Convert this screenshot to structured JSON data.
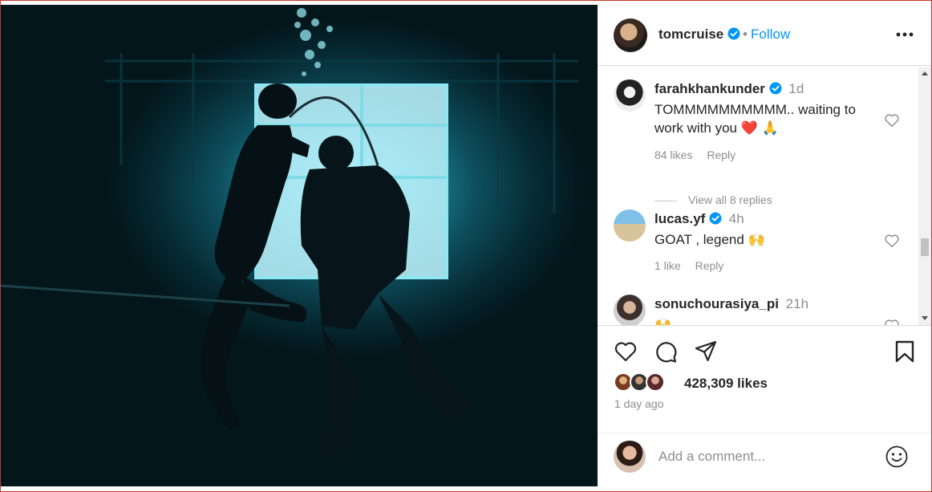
{
  "post": {
    "author": "tomcruise",
    "follow_label": "Follow",
    "separator": "•",
    "icons": {
      "verified": "verified-badge-icon",
      "more": "more-options-icon"
    }
  },
  "comments": [
    {
      "user": "farahkhankunder",
      "time": "1d",
      "text": "TOMMMMMMMMMM.. waiting to work with you ❤️ 🙏",
      "likes": "84 likes",
      "reply_label": "Reply",
      "view_replies": "View all 8 replies"
    },
    {
      "user": "lucas.yf",
      "time": "4h",
      "text": "GOAT , legend 🙌",
      "likes": "1 like",
      "reply_label": "Reply"
    },
    {
      "user": "sonuchourasiya_pi",
      "time": "21h",
      "text": "🙌"
    }
  ],
  "actions": {
    "icons": [
      "like-icon",
      "comment-icon",
      "share-icon",
      "save-icon"
    ],
    "likes_count": "428,309 likes",
    "time_ago": "1 day ago"
  },
  "add_comment": {
    "placeholder": "Add a comment...",
    "emoji_icon": "emoji-icon"
  },
  "colors": {
    "accent": "#0095f6",
    "muted": "#8e8e8e",
    "verified": "#0095f6"
  }
}
